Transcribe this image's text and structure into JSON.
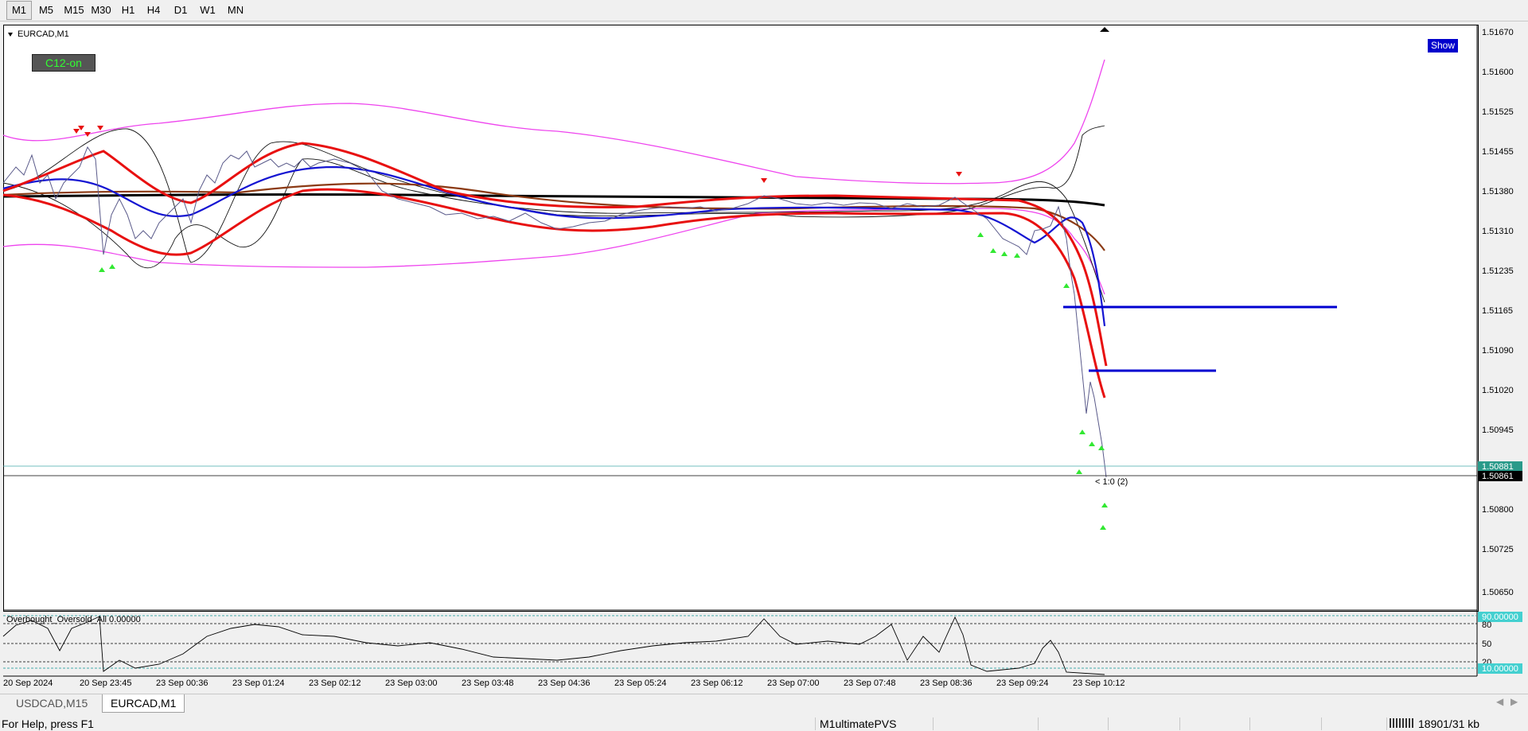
{
  "toolbar": {
    "timeframes": [
      "M1",
      "M5",
      "M15",
      "M30",
      "H1",
      "H4",
      "D1",
      "W1",
      "MN"
    ]
  },
  "chart": {
    "symbol_label": "EURCAD,M1",
    "c12_label": "C12-on",
    "show_label": "Show",
    "price_ticks": [
      "1.51670",
      "1.51600",
      "1.51525",
      "1.51455",
      "1.51380",
      "1.51310",
      "1.51235",
      "1.51165",
      "1.51090",
      "1.51020",
      "1.50945",
      "1.50881",
      "1.50861",
      "1.50800",
      "1.50725",
      "1.50650"
    ],
    "current_price": "1.50861",
    "ask_price": "1.50881",
    "trade_label": "< 1:0 (2)",
    "time_ticks": [
      "20 Sep 2024",
      "20 Sep 23:45",
      "23 Sep 00:36",
      "23 Sep 01:24",
      "23 Sep 02:12",
      "23 Sep 03:00",
      "23 Sep 03:48",
      "23 Sep 04:36",
      "23 Sep 05:24",
      "23 Sep 06:12",
      "23 Sep 07:00",
      "23 Sep 07:48",
      "23 Sep 08:36",
      "23 Sep 09:24",
      "23 Sep 10:12"
    ],
    "colors": {
      "ma_red": "#e81010",
      "ma_blue": "#1414d2",
      "ma_black": "#000000",
      "ma_brown": "#8b3a14",
      "envelope_magenta": "#ee44ee",
      "level_blue": "#0000d0",
      "arrow_green": "#32e832",
      "arrow_red": "#e81010",
      "candle": "#5a5a8a"
    }
  },
  "sub_window": {
    "title": "Overbought_Oversold_All 0.00000",
    "level_ticks": [
      "90.00000",
      "80",
      "50",
      "20",
      "10.00000"
    ]
  },
  "tabs": [
    "USDCAD,M15",
    "EURCAD,M1"
  ],
  "status": {
    "help": "For Help, press F1",
    "profile": "M1ultimatePVS",
    "traffic": "18901/31 kb"
  }
}
